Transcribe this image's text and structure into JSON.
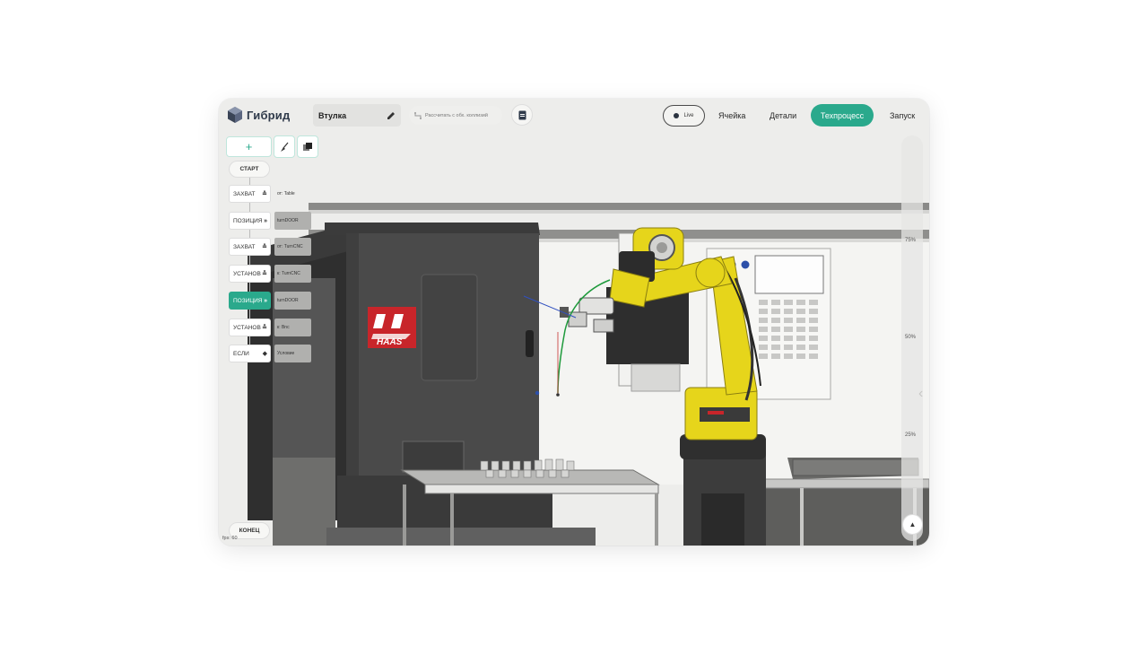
{
  "app": {
    "name": "Гибрид",
    "project_name": "Втулка",
    "collision_label": "Рассчитать с обх. коллизий"
  },
  "nav": {
    "live": "Live",
    "cell": "Ячейка",
    "parts": "Детали",
    "process": "Техпроцесс",
    "run": "Запуск"
  },
  "toolbar": {
    "add": "+"
  },
  "process": {
    "start": "СТАРТ",
    "end": "КОНЕЦ",
    "steps": [
      {
        "label": "ЗАХВАТ",
        "icon": "double-chevron-up-icon",
        "glyph": "⌃",
        "param": "от: Table",
        "active": false
      },
      {
        "label": "ПОЗИЦИЯ",
        "icon": "double-chevron-right-icon",
        "glyph": "»",
        "param": "turnDOOR",
        "active": false
      },
      {
        "label": "ЗАХВАТ",
        "icon": "double-chevron-up-icon",
        "glyph": "⌃",
        "param": "от: TurnCNC",
        "active": false
      },
      {
        "label": "УСТАНОВ",
        "icon": "double-chevron-down-icon",
        "glyph": "⌄",
        "param": "к: TurnCNC",
        "active": false
      },
      {
        "label": "ПОЗИЦИЯ",
        "icon": "double-chevron-right-icon",
        "glyph": "»",
        "param": "turnDOOR",
        "active": true
      },
      {
        "label": "УСТАНОВ",
        "icon": "double-chevron-down-icon",
        "glyph": "⌄",
        "param": "к: Bnc",
        "active": false
      },
      {
        "label": "ЕСЛИ",
        "icon": "diamond-icon",
        "glyph": "◆",
        "param": "Условие",
        "active": false
      }
    ]
  },
  "scale": {
    "ticks": [
      "75%",
      "50%",
      "25%"
    ]
  },
  "status": {
    "fps": "fps: 60"
  },
  "colors": {
    "accent": "#2aa98c",
    "robot_yellow": "#e6d51b",
    "machine_body": "#4d4d4d",
    "haas_red": "#c8252a"
  }
}
